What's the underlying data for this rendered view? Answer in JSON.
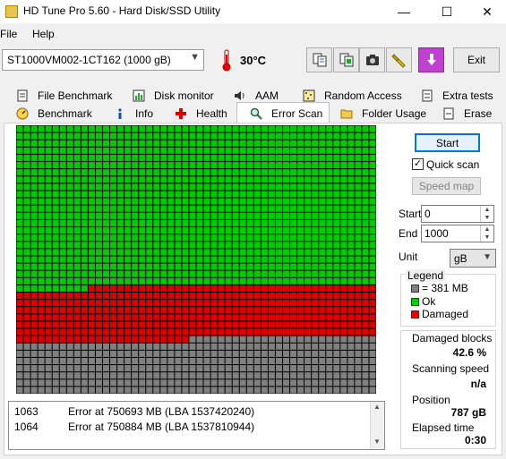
{
  "window": {
    "title": "HD Tune Pro 5.60 - Hard Disk/SSD Utility",
    "minimize_glyph": "—",
    "maximize_glyph": "☐",
    "close_glyph": "✕"
  },
  "menu": {
    "file": "File",
    "help": "Help"
  },
  "toolbar": {
    "drive": "ST1000VM002-1CT162 (1000 gB)",
    "temperature": "30°C",
    "exit_label": "Exit",
    "icons": [
      "copy-text-icon",
      "copy-info-icon",
      "screenshot-camera-icon",
      "options-wrench-icon",
      "save-download-icon"
    ]
  },
  "tabs_row1": [
    "File Benchmark",
    "Disk monitor",
    "AAM",
    "Random Access",
    "Extra tests"
  ],
  "tabs_row2": [
    "Benchmark",
    "Info",
    "Health",
    "Error Scan",
    "Folder Usage",
    "Erase"
  ],
  "active_tab": "Error Scan",
  "controls": {
    "start_label": "Start",
    "quick_scan_label": "Quick scan",
    "quick_scan_checked": true,
    "check_glyph": "✓",
    "speed_map_label": "Speed map",
    "start_field_label": "Start",
    "start_value": "0",
    "end_field_label": "End",
    "end_value": "1000",
    "unit_label": "Unit",
    "unit_value": "gB"
  },
  "legend": {
    "title": "Legend",
    "block_size": "= 381 MB",
    "ok": "Ok",
    "damaged": "Damaged"
  },
  "colors": {
    "ok": "#00cc00",
    "damaged": "#e00000",
    "unscanned": "#808080",
    "accent": "#0078d7"
  },
  "scan_progress": {
    "ok_fraction": 0.6,
    "damaged_fraction": 0.197,
    "unscanned_fraction": 0.203
  },
  "stats": {
    "damaged_blocks_label": "Damaged blocks",
    "damaged_blocks_value": "42.6 %",
    "scanning_speed_label": "Scanning speed",
    "scanning_speed_value": "n/a",
    "position_label": "Position",
    "position_value": "787 gB",
    "elapsed_label": "Elapsed time",
    "elapsed_value": "0:30"
  },
  "log": [
    {
      "num": "1063",
      "msg": "Error at 750693 MB (LBA 1537420240)"
    },
    {
      "num": "1064",
      "msg": "Error at 750884 MB (LBA 1537810944)"
    }
  ]
}
